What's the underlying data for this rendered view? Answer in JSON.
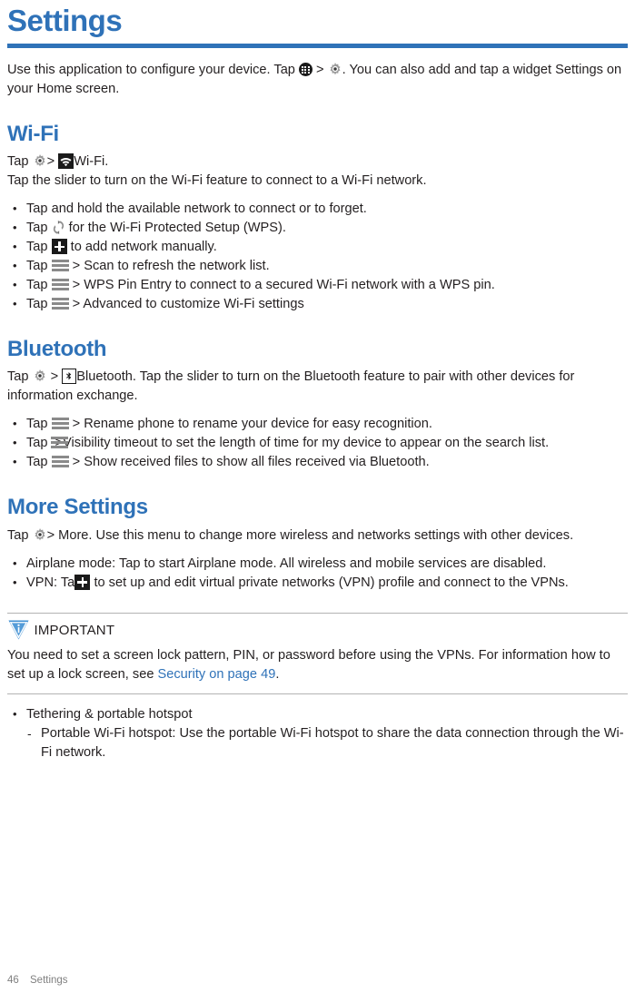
{
  "document": {
    "title": "Settings",
    "intro": {
      "before_apps": "Use this application to configure your device. Tap",
      "gt1": ">",
      "after_gear": ". You can also add and tap a widget Settings on your Home  screen."
    }
  },
  "sections": [
    {
      "id": "wifi",
      "heading": "Wi-Fi",
      "intro_line1_pre": "Tap",
      "intro_line1_gt": ">",
      "intro_line1_post": "Wi-Fi.",
      "intro_line2": "Tap the slider to turn on the Wi-Fi feature to connect to a Wi-Fi   network.",
      "bullets": [
        {
          "pre": "Tap and hold the available network to connect or to   forget.",
          "icon": "",
          "post": ""
        },
        {
          "pre": "Tap",
          "icon": "wps-icon",
          "post": "for the Wi-Fi Protected Setup (WPS)."
        },
        {
          "pre": "Tap",
          "icon": "plus-icon",
          "post": "to add network  manually."
        },
        {
          "pre": "Tap",
          "icon": "menu-icon",
          "post": "> Scan to refresh the network  list."
        },
        {
          "pre": "Tap",
          "icon": "menu-icon",
          "post": "> WPS Pin Entry to connect to a secured Wi-Fi network with a WPS   pin."
        },
        {
          "pre": "Tap",
          "icon": "menu-icon",
          "post": "> Advanced to customize Wi-Fi  settings"
        }
      ]
    },
    {
      "id": "bluetooth",
      "heading": "Bluetooth",
      "intro_pre": "Tap",
      "intro_gt": ">",
      "intro_post": "Bluetooth. Tap the slider to turn on the Bluetooth feature to pair with other devices for information  exchange.",
      "bullets": [
        {
          "pre": "Tap",
          "icon": "menu-icon",
          "post": "> Rename phone to rename your device for easy  recognition."
        },
        {
          "pre": "Tap",
          "icon": "menu-icon",
          "post": ">Visibility timeout to set the length of time for my device to appear on the search list."
        },
        {
          "pre": "Tap",
          "icon": "menu-icon",
          "post": "> Show received files to show all files received via  Bluetooth."
        }
      ]
    },
    {
      "id": "more-settings",
      "heading": "More Settings",
      "intro_pre": "Tap",
      "intro_post": "> More. Use this menu to change more wireless and networks settings with other devices.",
      "bullets": [
        {
          "pre": "Airplane mode: Tap to start Airplane mode. All wireless and mobile services are disabled.",
          "icon": "",
          "post": ""
        },
        {
          "pre": "VPN:   Tap",
          "icon": "plus-icon",
          "post": "to set up and edit virtual private networks (VPN) profile and connect to the VPNs."
        }
      ]
    }
  ],
  "note": {
    "icon": "important-icon",
    "label": "IMPORTANT",
    "body_pre": "You need to set a screen lock pattern, PIN, or password before using the VPNs. For information how to set up a lock screen, see",
    "link": "Security on page  49",
    "body_post": "."
  },
  "tethering": {
    "bullet": "Tethering & portable  hotspot",
    "sub": "Portable Wi-Fi hotspot: Use the portable Wi-Fi hotspot to share the data connection through the Wi-Fi network."
  },
  "footer": {
    "page_number": "46",
    "chapter": "Settings"
  },
  "colors": {
    "accent_blue": "#2f72b8",
    "text": "#231f20",
    "icon_gray": "#8a8a8a",
    "footer_gray": "#808080",
    "rule_gray": "#b3b3b3"
  }
}
